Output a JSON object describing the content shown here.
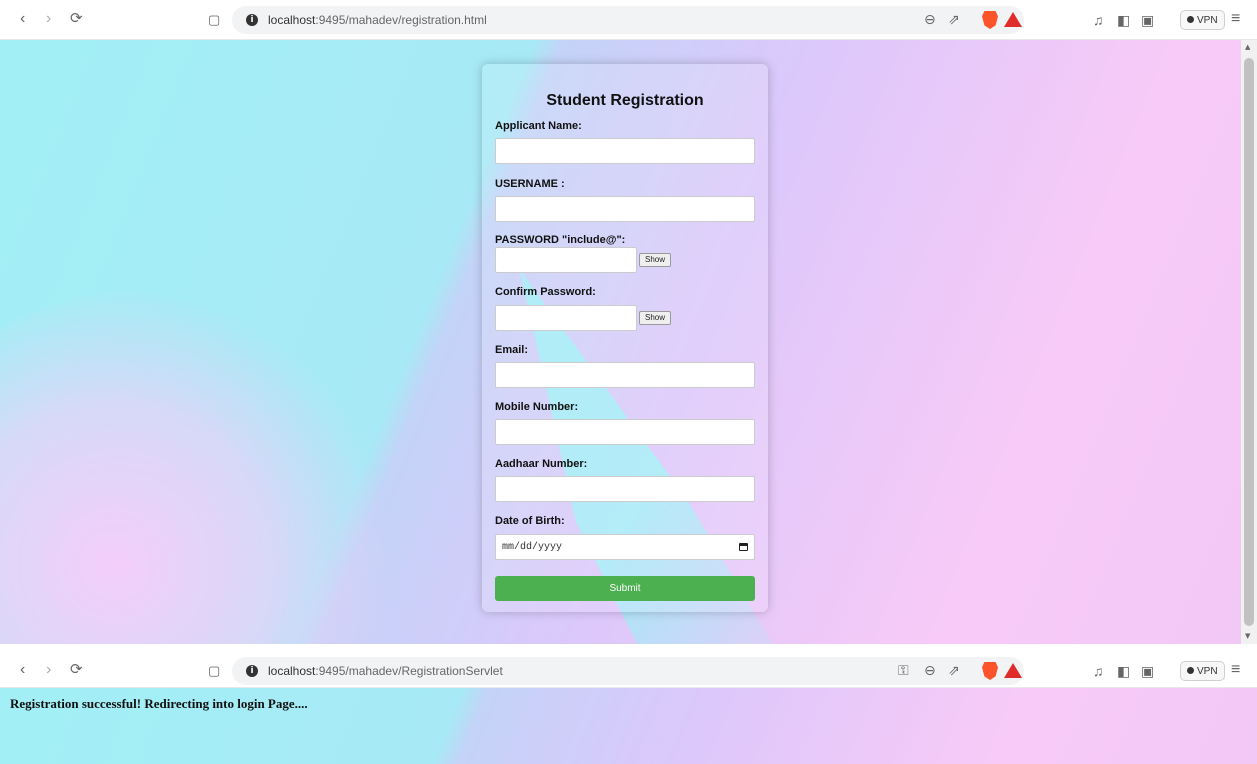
{
  "window_top": {
    "url_host": "localhost",
    "url_path": ":9495/mahadev/registration.html",
    "vpn_label": "VPN",
    "form": {
      "title": "Student Registration",
      "fields": [
        {
          "label": "Applicant Name:",
          "value": ""
        },
        {
          "label": "USERNAME :",
          "value": ""
        },
        {
          "label": "PASSWORD \"include@\":",
          "value": ""
        },
        {
          "label": "Confirm Password:",
          "value": ""
        },
        {
          "label": "Email:",
          "value": ""
        },
        {
          "label": "Mobile Number:",
          "value": ""
        },
        {
          "label": "Aadhaar Number:",
          "value": ""
        },
        {
          "label": "Date of Birth:",
          "placeholder": "mm/dd/yyyy"
        }
      ],
      "show_label": "Show",
      "submit_label": "Submit"
    }
  },
  "window_bottom": {
    "url_host": "localhost",
    "url_path": ":9495/mahadev/RegistrationServlet",
    "vpn_label": "VPN",
    "message": "Registration successful! Redirecting into login Page...."
  },
  "colors": {
    "submit_button": "#4caf50",
    "gradient_cyan": "#a2f0f6",
    "gradient_pink": "#f8caf7",
    "brave_icon": "#fb542b"
  },
  "icons": [
    "back-icon",
    "forward-icon",
    "reload-icon",
    "bookmark-icon",
    "site-info-icon",
    "zoom-icon",
    "share-icon",
    "brave-shield-icon",
    "brave-rewards-icon",
    "media-icon",
    "sidebar-icon",
    "wallet-icon",
    "menu-icon",
    "key-icon",
    "calendar-icon"
  ]
}
